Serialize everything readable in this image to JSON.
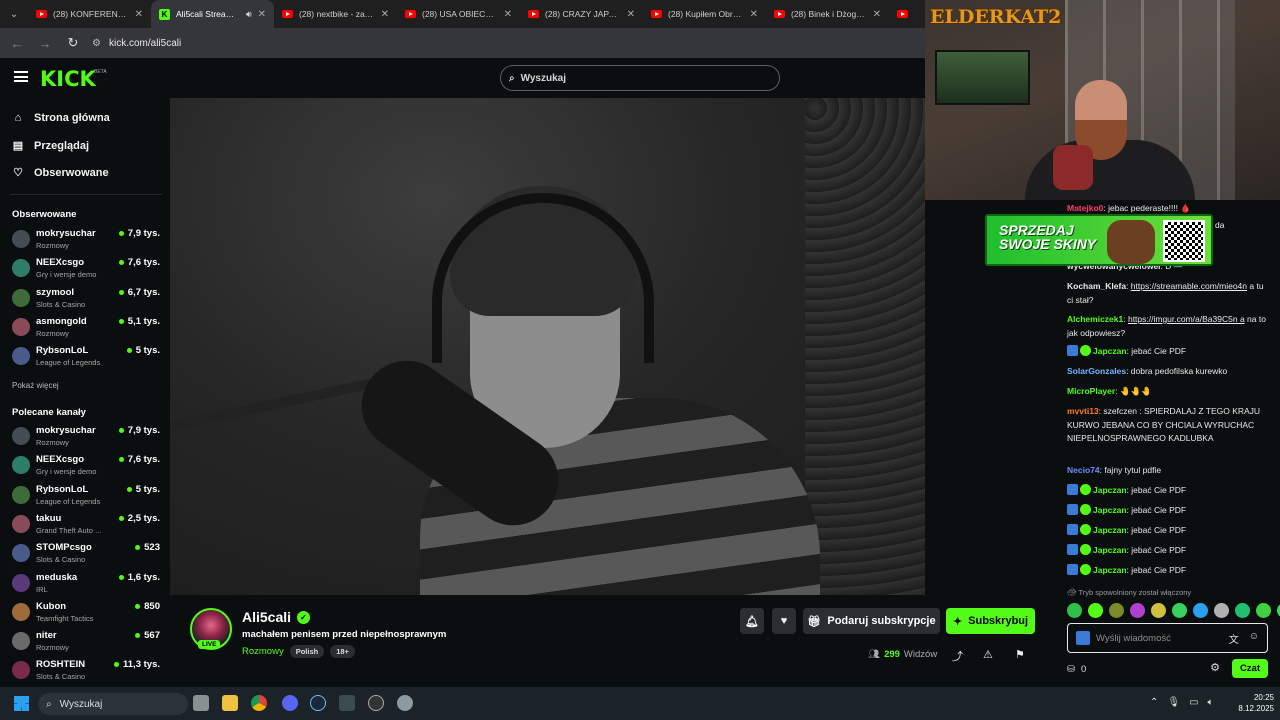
{
  "browser": {
    "tabs": [
      {
        "title": "(28) KONFERENCJA: N",
        "type": "yt"
      },
      {
        "title": "Ali5cali Stream - W",
        "type": "kick",
        "active": true
      },
      {
        "title": "(28) nextbike - zawsze",
        "type": "yt"
      },
      {
        "title": "(28) USA OBIECUJE W",
        "type": "yt"
      },
      {
        "title": "(28) CRAZY JAPANESE",
        "type": "yt"
      },
      {
        "title": "(28) Kupiłem Obraz n",
        "type": "yt"
      },
      {
        "title": "(28) Binek i Dżogo | D",
        "type": "yt"
      },
      {
        "title": "(28",
        "type": "yt"
      }
    ],
    "url": "kick.com/ali5cali"
  },
  "header": {
    "logo": "KICK",
    "beta": "BETA",
    "search_placeholder": "Wyszukaj"
  },
  "sidebar": {
    "nav": [
      {
        "label": "Strona główna",
        "icon": "home-icon"
      },
      {
        "label": "Przeglądaj",
        "icon": "browse-icon"
      },
      {
        "label": "Obserwowane",
        "icon": "heart-icon"
      }
    ],
    "followed_title": "Obserwowane",
    "followed": [
      {
        "name": "mokrysuchar",
        "category": "Rozmowy",
        "viewers": "7,9 tys."
      },
      {
        "name": "NEEXcsgo",
        "category": "Gry i wersje demo",
        "viewers": "7,6 tys."
      },
      {
        "name": "szymool",
        "category": "Slots & Casino",
        "viewers": "6,7 tys."
      },
      {
        "name": "asmongold",
        "category": "Rozmowy",
        "viewers": "5,1 tys."
      },
      {
        "name": "RybsonLoL",
        "category": "League of Legends",
        "viewers": "5 tys."
      }
    ],
    "show_more": "Pokaż więcej",
    "recommended_title": "Polecane kanały",
    "recommended": [
      {
        "name": "mokrysuchar",
        "category": "Rozmowy",
        "viewers": "7,9 tys."
      },
      {
        "name": "NEEXcsgo",
        "category": "Gry i wersje demo",
        "viewers": "7,6 tys."
      },
      {
        "name": "RybsonLoL",
        "category": "League of Legends",
        "viewers": "5 tys."
      },
      {
        "name": "takuu",
        "category": "Grand Theft Auto ...",
        "viewers": "2,5 tys."
      },
      {
        "name": "STOMPcsgo",
        "category": "Slots & Casino",
        "viewers": "523"
      },
      {
        "name": "meduska",
        "category": "IRL",
        "viewers": "1,6 tys."
      },
      {
        "name": "Kubon",
        "category": "Teamfight Tactics",
        "viewers": "850"
      },
      {
        "name": "niter",
        "category": "Rozmowy",
        "viewers": "567"
      },
      {
        "name": "ROSHTEIN",
        "category": "Slots & Casino",
        "viewers": "11,3 tys."
      }
    ]
  },
  "stream": {
    "live_badge": "LIVE",
    "channel": "Ali5cali",
    "title": "machałem penisem przed niepełnosprawnym",
    "category": "Rozmowy",
    "tags": [
      "Polish",
      "18+"
    ],
    "gift_label": "Podaruj subskrypcje",
    "subscribe_label": "Subskrybuj",
    "viewers_count": "299",
    "viewers_label": "Widzów"
  },
  "overlay": {
    "webcam_logo": "ELDERKAT2",
    "banner_text_line1": "SPRZEDAJ",
    "banner_text_line2": "SWOJE SKINY"
  },
  "chat": {
    "messages": [
      {
        "user": "Matejko0",
        "color": "#ff3b6b",
        "text": "jebac pederaste!!!! 🩸"
      },
      {
        "user": "",
        "color": "#53fc18",
        "text": "da"
      },
      {
        "user": "wycwelowanycwelowel",
        "color": "#e8e8e8",
        "text": "D —"
      },
      {
        "user": "Kocham_Klefa",
        "color": "#e8e8e8",
        "text": "a tu ci stał?",
        "link": "https://streamable.com/mieo4n"
      },
      {
        "user": "Alchemiczek1",
        "color": "#53fc18",
        "text": "na to jak odpowiesz?",
        "link": "https://imgur.com/a/Ba39C5n a"
      },
      {
        "user": "Japczan",
        "color": "#53fc18",
        "text": "jebać Cie PDF",
        "badges": true
      },
      {
        "user": "SolarGonzales",
        "color": "#6fb7ff",
        "text": "dobra pedofilska kurewko"
      },
      {
        "user": "MicroPlayer",
        "color": "#53fc18",
        "text": "🤚🤚🤚"
      },
      {
        "user": "mvvti13",
        "color": "#ff7a1a",
        "text": "szefczen : SPIERDALAJ Z TEGO KRAJU KURWO JEBANA CO BY CHCIALA WYRUCHAC NIEPELNOSPRAWNEGO KADLUBKA"
      },
      {
        "user": "Necio74",
        "color": "#6f8cff",
        "text": "fajny tytul pdfie"
      },
      {
        "user": "Japczan",
        "color": "#53fc18",
        "text": "jebać Cie PDF",
        "badges": true
      },
      {
        "user": "Japczan",
        "color": "#53fc18",
        "text": "jebać Cie PDF",
        "badges": true
      },
      {
        "user": "Japczan",
        "color": "#53fc18",
        "text": "jebać Cie PDF",
        "badges": true
      },
      {
        "user": "Japczan",
        "color": "#53fc18",
        "text": "jebać Cie PDF",
        "badges": true
      },
      {
        "user": "Japczan",
        "color": "#53fc18",
        "text": "jebać Cie PDF",
        "badges": true
      }
    ],
    "slow_mode": "Tryb spowolniony został włączony",
    "input_placeholder": "Wyślij wiadomość",
    "points": "0",
    "send_label": "Czat"
  },
  "taskbar": {
    "search": "Wyszukaj",
    "time": "20:25",
    "date": "8.12.2025"
  }
}
